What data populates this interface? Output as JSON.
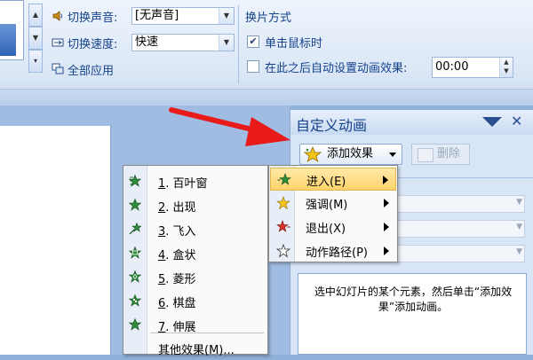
{
  "ribbon": {
    "sound_label": "切换声音:",
    "sound_value": "[无声音]",
    "speed_label": "切换速度:",
    "speed_value": "快速",
    "apply_all": "全部应用",
    "advance_group_title": "换片方式",
    "on_click_label": "单击鼠标时",
    "on_click_checked": true,
    "auto_after_label": "在此之后自动设置动画效果:",
    "auto_after_checked": false,
    "auto_after_time": "00:00"
  },
  "task_pane": {
    "title": "自定义动画",
    "add_effect_label": "添加效果",
    "delete_label": "删除",
    "hint": "选中幻灯片的某个元素，然后单击“添加效果”添加动画。"
  },
  "effects_menu": {
    "items": [
      {
        "num": "1",
        "label": ". 百叶窗"
      },
      {
        "num": "2",
        "label": ". 出现"
      },
      {
        "num": "3",
        "label": ". 飞入"
      },
      {
        "num": "4",
        "label": ". 盒状"
      },
      {
        "num": "5",
        "label": ". 菱形"
      },
      {
        "num": "6",
        "label": ". 棋盘"
      },
      {
        "num": "7",
        "label": ". 伸展"
      }
    ],
    "more_label": "其他效果(M)..."
  },
  "add_effect_menu": {
    "items": [
      {
        "label": "进入(E)",
        "icon": "enter-star-icon",
        "highlighted": true
      },
      {
        "label": "强调(M)",
        "icon": "emphasis-star-icon",
        "highlighted": false
      },
      {
        "label": "退出(X)",
        "icon": "exit-star-icon",
        "highlighted": false
      },
      {
        "label": "动作路径(P)",
        "icon": "motion-path-star-icon",
        "highlighted": false
      }
    ]
  },
  "colors": {
    "enter_star": "#2e8b3a",
    "emphasis_star": "#f5c518",
    "exit_star": "#d9342b",
    "annotation_arrow": "#e81a1a",
    "menu_highlight": "#ffd36b"
  }
}
